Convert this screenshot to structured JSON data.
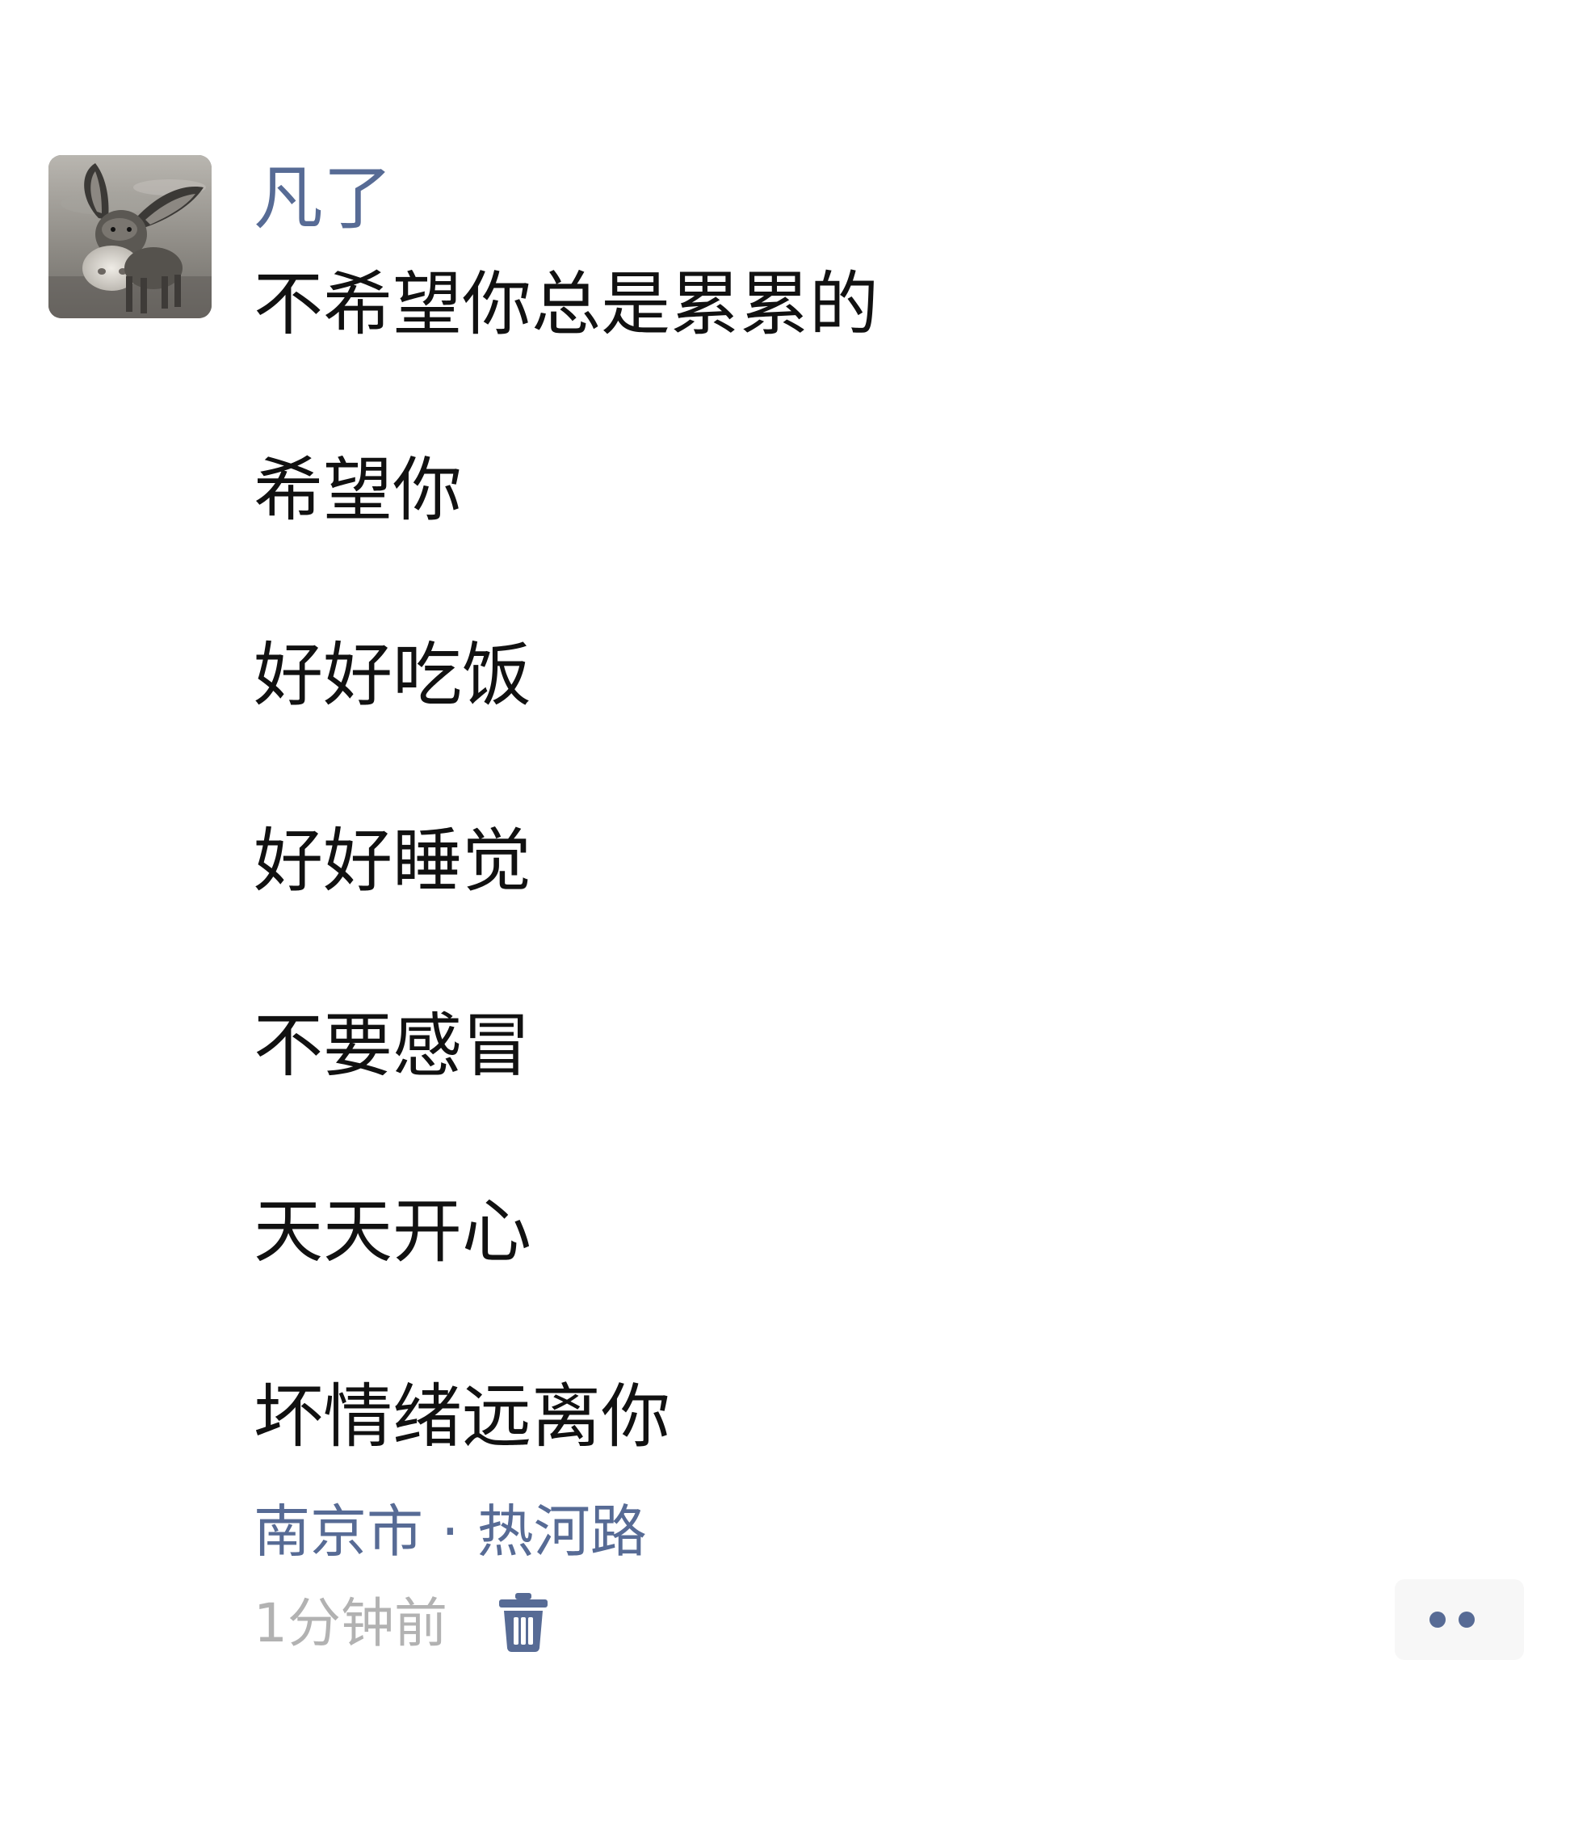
{
  "post": {
    "author": {
      "name": "凡了",
      "avatar_icon": "donkey-avatar-icon"
    },
    "lines": [
      "不希望你总是累累的",
      " 希望你",
      " 好好吃饭",
      " 好好睡觉",
      "不要感冒",
      " 天天开心",
      " 坏情绪远离你"
    ],
    "location": "南京市 · 热河路",
    "time": "1分钟前",
    "delete_icon": "trash-icon",
    "more_icon": "more-dots-icon"
  },
  "colors": {
    "link": "#576b95",
    "text": "#111111",
    "muted": "#b2b2b2",
    "button_bg": "#f7f7f7"
  }
}
